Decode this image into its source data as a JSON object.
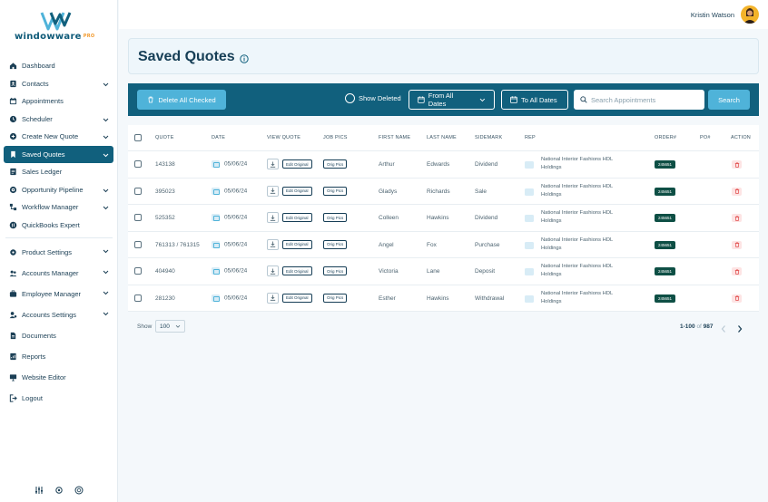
{
  "brand": {
    "name": "windowware",
    "suffix": "PRO",
    "accent": "#11607d",
    "accent_light": "#4fb3d9",
    "orange": "#f29a2e"
  },
  "user": {
    "name": "Kristin Watson"
  },
  "sidebar": {
    "items": [
      {
        "label": "Dashboard",
        "icon": "home-icon",
        "chevron": false
      },
      {
        "label": "Contacts",
        "icon": "contacts-icon",
        "chevron": true
      },
      {
        "label": "Appointments",
        "icon": "calendar-icon",
        "chevron": false
      },
      {
        "label": "Scheduler",
        "icon": "clock-icon",
        "chevron": true
      },
      {
        "label": "Create New Quote",
        "icon": "plus-circle-icon",
        "chevron": true
      },
      {
        "label": "Saved Quotes",
        "icon": "bookmark-icon",
        "chevron": true,
        "active": true
      },
      {
        "label": "Sales Ledger",
        "icon": "ledger-icon",
        "chevron": false
      },
      {
        "label": "Opportunity Pipeline",
        "icon": "pipeline-icon",
        "chevron": true
      },
      {
        "label": "Workflow Manager",
        "icon": "workflow-icon",
        "chevron": true
      },
      {
        "label": "QuickBooks Expert",
        "icon": "quickbooks-icon",
        "chevron": false
      }
    ],
    "items2": [
      {
        "label": "Product Settings",
        "icon": "gear-icon",
        "chevron": true
      },
      {
        "label": "Accounts Manager",
        "icon": "users-icon",
        "chevron": true
      },
      {
        "label": "Employee Manager",
        "icon": "employee-icon",
        "chevron": true
      },
      {
        "label": "Accounts Settings",
        "icon": "user-gear-icon",
        "chevron": true
      },
      {
        "label": "Documents",
        "icon": "document-icon",
        "chevron": false
      },
      {
        "label": "Reports",
        "icon": "report-icon",
        "chevron": false
      },
      {
        "label": "Website Editor",
        "icon": "monitor-icon",
        "chevron": false
      },
      {
        "label": "Logout",
        "icon": "logout-icon",
        "chevron": false
      }
    ],
    "bottom_icons": [
      "sliders-icon",
      "settings-icon",
      "support-icon"
    ]
  },
  "page": {
    "title": "Saved Quotes"
  },
  "toolbar": {
    "delete_label": "Delete All Checked",
    "show_deleted_label": "Show Deleted",
    "from_dates_label": "From All Dates",
    "to_dates_label": "To All Dates",
    "search_placeholder": "Search Appointments",
    "search_label": "Search"
  },
  "table": {
    "headers": {
      "quote": "QUOTE",
      "date": "DATE",
      "view_quote": "VIEW QUOTE",
      "job_pics": "JOB PICS",
      "first_name": "FIRST NAME",
      "last_name": "LAST NAME",
      "sidemark": "SIDEMARK",
      "rep": "REP",
      "order": "ORDER#",
      "po": "PO#",
      "action": "ACTION"
    },
    "edit_label": "Edit Original",
    "pics_label": "Orig Pics",
    "rows": [
      {
        "quote": "143138",
        "date": "05/06/24",
        "first": "Arthur",
        "last": "Edwards",
        "sidemark": "Dividend",
        "rep": "National Interior Fashions HDL Holdings",
        "order": "245651"
      },
      {
        "quote": "395023",
        "date": "05/06/24",
        "first": "Gladys",
        "last": "Richards",
        "sidemark": "Sale",
        "rep": "National Interior Fashions HDL Holdings",
        "order": "245651"
      },
      {
        "quote": "525352",
        "date": "05/06/24",
        "first": "Colleen",
        "last": "Hawkins",
        "sidemark": "Dividend",
        "rep": "National Interior Fashions HDL Holdings",
        "order": "245651"
      },
      {
        "quote": "761313 / 761315",
        "date": "05/06/24",
        "first": "Angel",
        "last": "Fox",
        "sidemark": "Purchase",
        "rep": "National Interior Fashions HDL Holdings",
        "order": "245651"
      },
      {
        "quote": "404940",
        "date": "05/06/24",
        "first": "Victoria",
        "last": "Lane",
        "sidemark": "Deposit",
        "rep": "National Interior Fashions HDL Holdings",
        "order": "245651"
      },
      {
        "quote": "281230",
        "date": "05/06/24",
        "first": "Esther",
        "last": "Hawkins",
        "sidemark": "Withdrawal",
        "rep": "National Interior Fashions HDL Holdings",
        "order": "245651"
      }
    ]
  },
  "footer": {
    "show_label": "Show",
    "page_size": "100",
    "range": "1-100",
    "of_label": "of",
    "total": "987"
  }
}
